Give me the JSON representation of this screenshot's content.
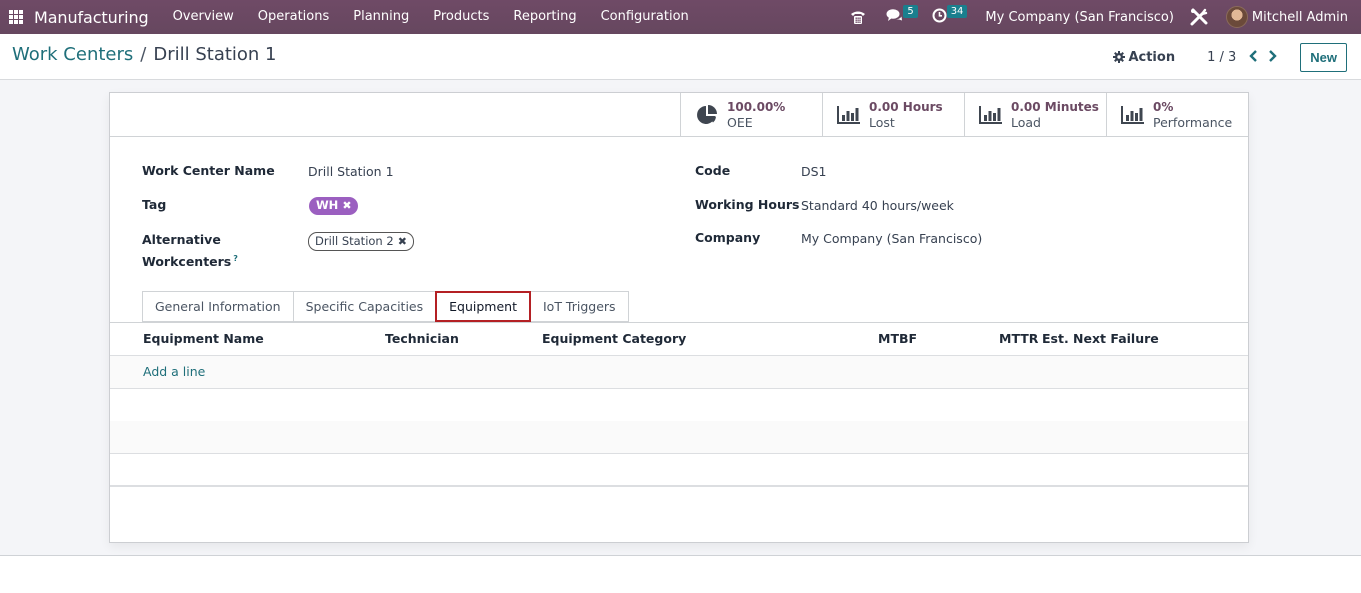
{
  "navbar": {
    "app_name": "Manufacturing",
    "menu": [
      "Overview",
      "Operations",
      "Planning",
      "Products",
      "Reporting",
      "Configuration"
    ],
    "messages_count": "5",
    "activities_count": "34",
    "company": "My Company (San Francisco)",
    "user": "Mitchell Admin",
    "icons": [
      "apps-grid-icon",
      "phone-icon",
      "chat-icon",
      "clock-icon",
      "tools-icon",
      "avatar"
    ]
  },
  "control_panel": {
    "breadcrumb_parent": "Work Centers",
    "breadcrumb_separator": "/",
    "breadcrumb_current": "Drill Station 1",
    "action_label": "Action",
    "pager": "1 / 3",
    "new_label": "New"
  },
  "stat_buttons": [
    {
      "value": "100.00%",
      "label": "OEE",
      "icon": "pie-chart-icon"
    },
    {
      "value": "0.00 Hours",
      "label": "Lost",
      "icon": "bar-chart-icon"
    },
    {
      "value": "0.00 Minutes",
      "label": "Load",
      "icon": "bar-chart-icon"
    },
    {
      "value": "0%",
      "label": "Performance",
      "icon": "bar-chart-icon"
    }
  ],
  "form": {
    "work_center_name_label": "Work Center Name",
    "work_center_name": "Drill Station 1",
    "tag_label": "Tag",
    "tag": "WH",
    "tag_color": "#9b5fc0",
    "alt_label_line1": "Alternative",
    "alt_label_line2": "Workcenters",
    "alt_help": "?",
    "alternative_workcenter": "Drill Station 2",
    "code_label": "Code",
    "code": "DS1",
    "working_hours_label": "Working Hours",
    "working_hours": "Standard 40 hours/week",
    "company_label": "Company",
    "company": "My Company (San Francisco)"
  },
  "tabs": [
    {
      "label": "General Information",
      "active": false
    },
    {
      "label": "Specific Capacities",
      "active": false
    },
    {
      "label": "Equipment",
      "active": true
    },
    {
      "label": "IoT Triggers",
      "active": false
    }
  ],
  "equipment_table": {
    "columns": [
      "Equipment Name",
      "Technician",
      "Equipment Category",
      "MTBF",
      "MTTR",
      "Est. Next Failure"
    ],
    "rows": [],
    "add_line_label": "Add a line"
  },
  "colors": {
    "navbar": "#714b67",
    "accent": "#1f6f7a",
    "highlight_border": "#b42024",
    "stat_value": "#6b4a63"
  }
}
